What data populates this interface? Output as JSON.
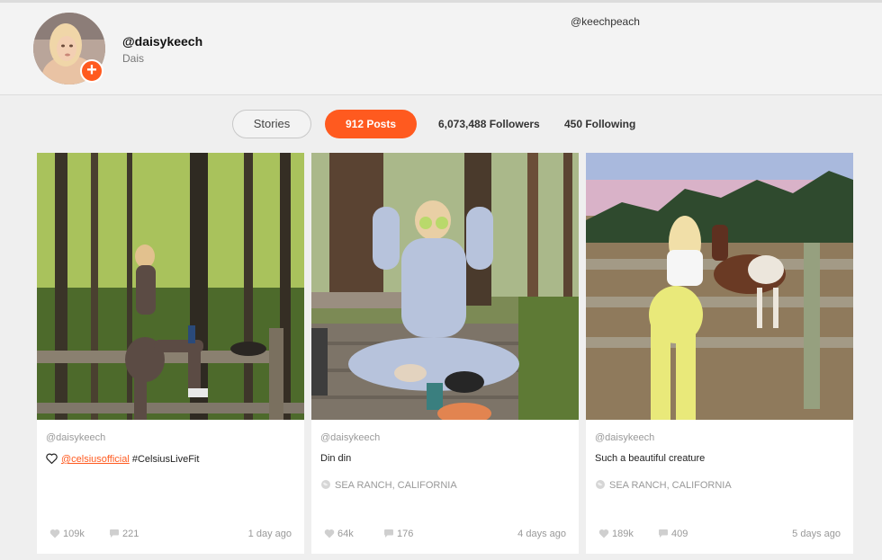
{
  "profile": {
    "username": "@daisykeech",
    "display_name": "Dais",
    "alt_handle": "@keechpeach",
    "add_icon": "plus-icon"
  },
  "stats": {
    "stories_label": "Stories",
    "posts_label": "912 Posts",
    "followers_label": "6,073,488 Followers",
    "following_label": "450 Following"
  },
  "colors": {
    "accent": "#ff5a1f",
    "muted_text": "#999999",
    "background": "#efefef"
  },
  "posts": [
    {
      "author": "@daisykeech",
      "caption_mention": "@celsiusofficial",
      "caption_rest": " #CelsiusLiveFit",
      "location": "",
      "likes": "109k",
      "comments": "221",
      "date": "1 day ago"
    },
    {
      "author": "@daisykeech",
      "caption": "Din din",
      "location": "SEA RANCH, CALIFORNIA",
      "likes": "64k",
      "comments": "176",
      "date": "4 days ago"
    },
    {
      "author": "@daisykeech",
      "caption": "Such a beautiful creature",
      "location": "SEA RANCH, CALIFORNIA",
      "likes": "189k",
      "comments": "409",
      "date": "5 days ago"
    }
  ]
}
